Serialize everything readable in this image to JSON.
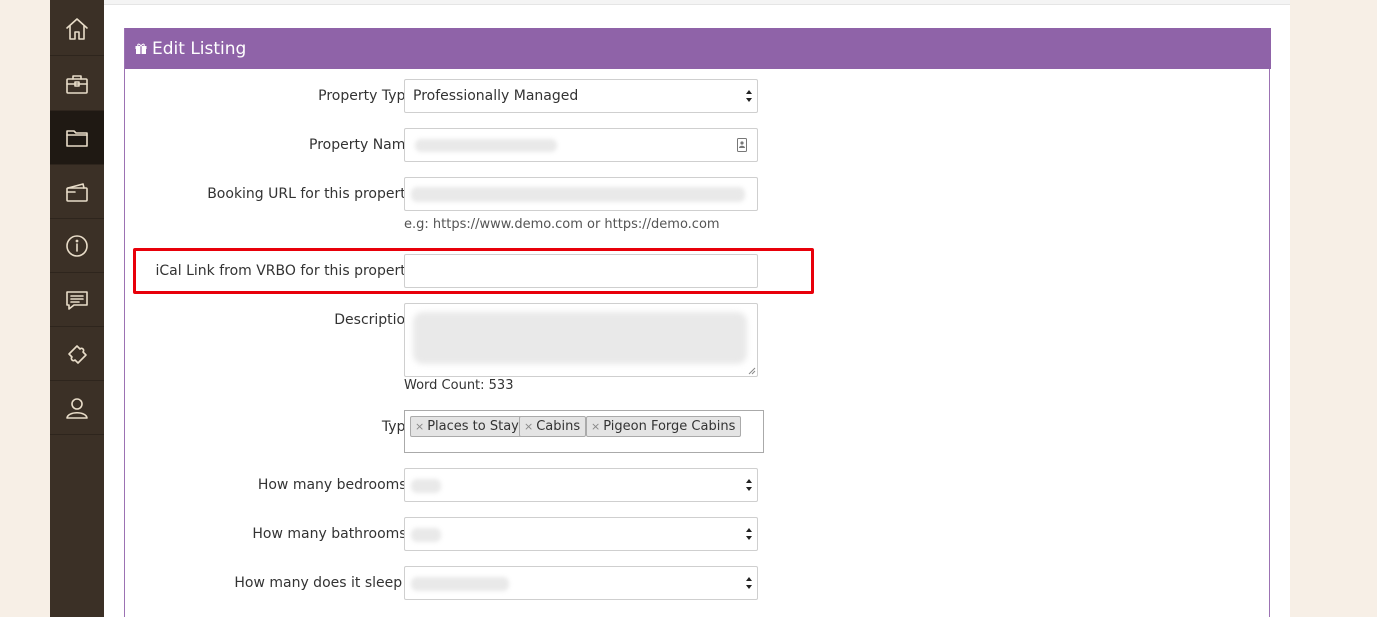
{
  "sidebar": {
    "items": [
      {
        "icon": "home-icon",
        "active": false
      },
      {
        "icon": "briefcase-icon",
        "active": false
      },
      {
        "icon": "folder-icon",
        "active": true
      },
      {
        "icon": "wallet-icon",
        "active": false
      },
      {
        "icon": "info-icon",
        "active": false
      },
      {
        "icon": "message-icon",
        "active": false
      },
      {
        "icon": "puzzle-icon",
        "active": false
      },
      {
        "icon": "user-icon",
        "active": false
      }
    ]
  },
  "panel": {
    "title": "Edit Listing",
    "header_color": "#8f63a8"
  },
  "form": {
    "property_type": {
      "label": "Property Type",
      "value": "Professionally Managed"
    },
    "property_name": {
      "label": "Property Name",
      "value": ""
    },
    "booking_url": {
      "label": "Booking URL for this property",
      "value": "",
      "hint": "e.g: https://www.demo.com or https://demo.com"
    },
    "ical_link": {
      "label": "iCal  Link from VRBO for this property",
      "value": ""
    },
    "description": {
      "label": "Description",
      "word_count_label": "Word Count:  533"
    },
    "type": {
      "label": "Type",
      "tags": [
        "Places to Stay",
        "Cabins",
        "Pigeon Forge Cabins"
      ],
      "remove_glyph": "×"
    },
    "bedrooms": {
      "label": "How many bedrooms?",
      "value": ""
    },
    "bathrooms": {
      "label": "How many bathrooms?",
      "value": ""
    },
    "sleeps": {
      "label": "How many does it sleep ?",
      "value": ""
    }
  },
  "highlight_color": "#e8000a"
}
